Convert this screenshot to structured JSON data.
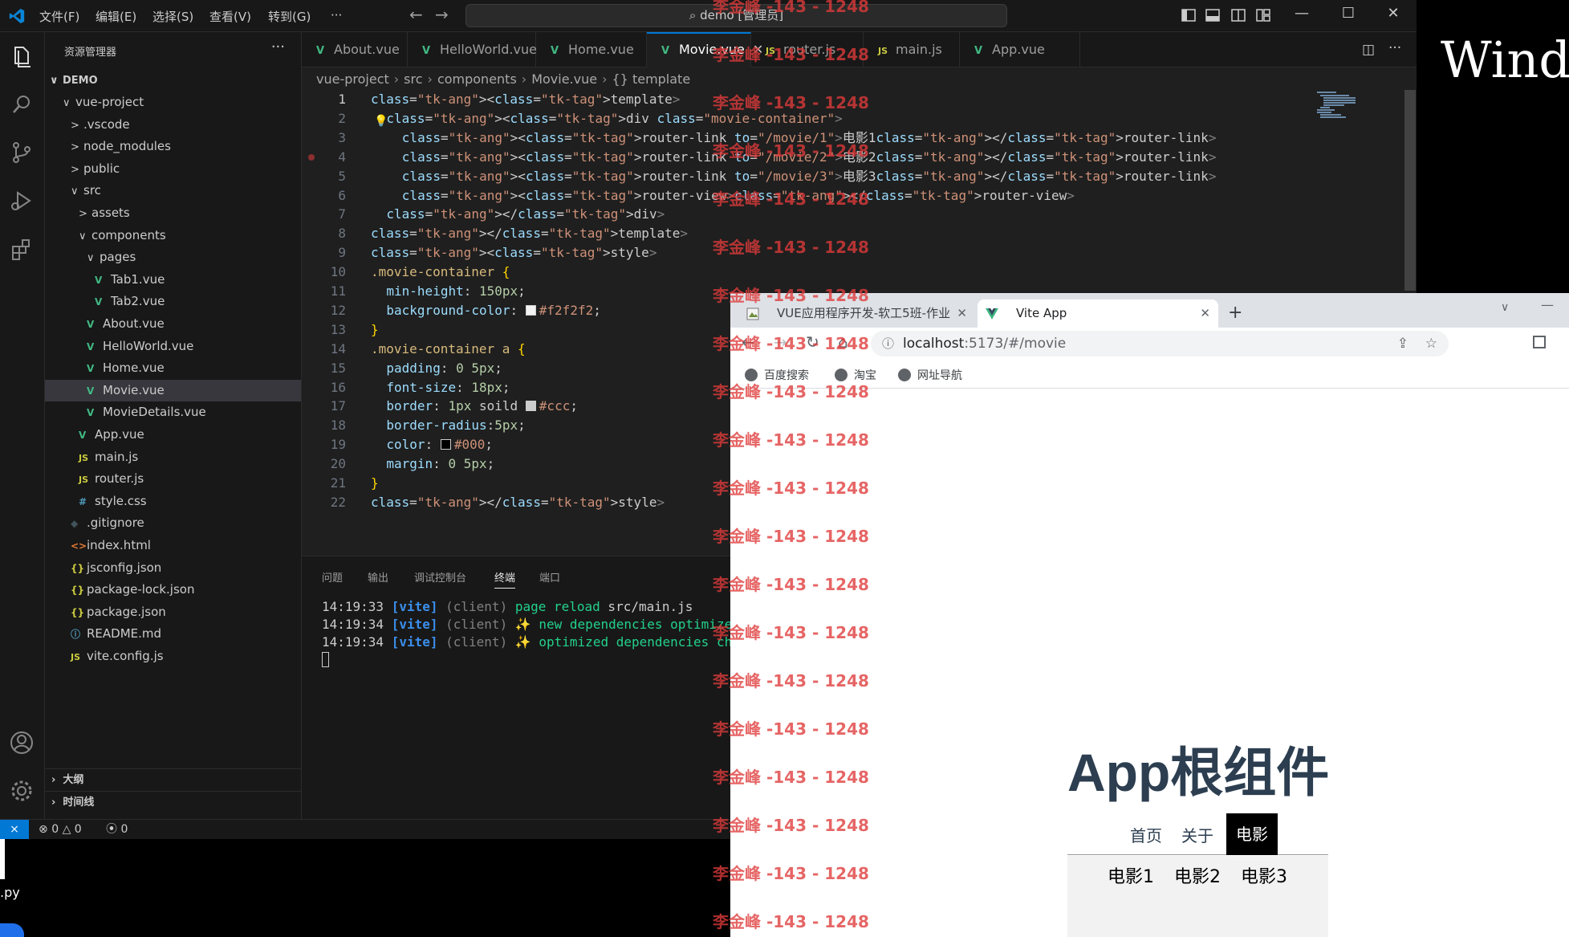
{
  "vscode": {
    "title": "demo [管理员]",
    "menu": [
      "文件(F)",
      "编辑(E)",
      "选择(S)",
      "查看(V)",
      "转到(G)",
      "···"
    ],
    "explorer_title": "资源管理器",
    "explorer_more": "···",
    "root": "DEMO",
    "tree": [
      {
        "label": "vue-project",
        "chev": "∨",
        "icon": "",
        "type": "folder"
      },
      {
        "label": ".vscode",
        "chev": ">",
        "icon": "",
        "type": "folder"
      },
      {
        "label": "node_modules",
        "chev": ">",
        "icon": "",
        "type": "folder"
      },
      {
        "label": "public",
        "chev": ">",
        "icon": "",
        "type": "folder"
      },
      {
        "label": "src",
        "chev": "∨",
        "icon": "",
        "type": "folder"
      },
      {
        "label": "assets",
        "chev": ">",
        "icon": "",
        "type": "folder"
      },
      {
        "label": "components",
        "chev": "∨",
        "icon": "",
        "type": "folder"
      },
      {
        "label": "pages",
        "chev": "∨",
        "icon": "",
        "type": "folder"
      },
      {
        "label": "Tab1.vue",
        "chev": "",
        "icon": "V",
        "type": "vue"
      },
      {
        "label": "Tab2.vue",
        "chev": "",
        "icon": "V",
        "type": "vue"
      },
      {
        "label": "About.vue",
        "chev": "",
        "icon": "V",
        "type": "vue"
      },
      {
        "label": "HelloWorld.vue",
        "chev": "",
        "icon": "V",
        "type": "vue"
      },
      {
        "label": "Home.vue",
        "chev": "",
        "icon": "V",
        "type": "vue"
      },
      {
        "label": "Movie.vue",
        "chev": "",
        "icon": "V",
        "type": "vue"
      },
      {
        "label": "MovieDetails.vue",
        "chev": "",
        "icon": "V",
        "type": "vue"
      },
      {
        "label": "App.vue",
        "chev": "",
        "icon": "V",
        "type": "vue"
      },
      {
        "label": "main.js",
        "chev": "",
        "icon": "JS",
        "type": "js"
      },
      {
        "label": "router.js",
        "chev": "",
        "icon": "JS",
        "type": "js"
      },
      {
        "label": "style.css",
        "chev": "",
        "icon": "#",
        "type": "css"
      },
      {
        "label": ".gitignore",
        "chev": "",
        "icon": "◆",
        "type": "git"
      },
      {
        "label": "index.html",
        "chev": "",
        "icon": "<>",
        "type": "html"
      },
      {
        "label": "jsconfig.json",
        "chev": "",
        "icon": "{}",
        "type": "json"
      },
      {
        "label": "package-lock.json",
        "chev": "",
        "icon": "{}",
        "type": "json"
      },
      {
        "label": "package.json",
        "chev": "",
        "icon": "{}",
        "type": "json"
      },
      {
        "label": "README.md",
        "chev": "",
        "icon": "ⓘ",
        "type": "info"
      },
      {
        "label": "vite.config.js",
        "chev": "",
        "icon": "JS",
        "type": "js"
      }
    ],
    "selected_file": "Movie.vue",
    "outline": "大纲",
    "timeline": "时间线",
    "tabs": [
      {
        "label": "About.vue",
        "icon": "V",
        "type": "vue"
      },
      {
        "label": "HelloWorld.vue",
        "icon": "V",
        "type": "vue"
      },
      {
        "label": "Home.vue",
        "icon": "V",
        "type": "vue"
      },
      {
        "label": "Movie.vue",
        "icon": "V",
        "type": "vue",
        "active": true
      },
      {
        "label": "router.js",
        "icon": "JS",
        "type": "js"
      },
      {
        "label": "main.js",
        "icon": "JS",
        "type": "js"
      },
      {
        "label": "App.vue",
        "icon": "V",
        "type": "vue"
      }
    ],
    "breadcrumb": [
      "vue-project",
      "src",
      "components",
      "Movie.vue",
      "{} template"
    ],
    "code_lines": [
      "<template>",
      "  <div class=\"movie-container\">",
      "    <router-link to=\"/movie/1\">电影1</router-link>",
      "    <router-link to=\"/movie/2\">电影2</router-link>",
      "    <router-link to=\"/movie/3\">电影3</router-link>",
      "    <router-view></router-view>",
      "  </div>",
      "</template>",
      "<style>",
      ".movie-container {",
      "  min-height: 150px;",
      "  background-color: #f2f2f2;",
      "}",
      ".movie-container a {",
      "  padding: 0 5px;",
      "  font-size: 18px;",
      "  border: 1px soild #ccc;",
      "  border-radius:5px;",
      "  color: #000;",
      "  margin: 0 5px;",
      "}",
      "</style>"
    ],
    "panel_tabs": [
      "问题",
      "输出",
      "调试控制台",
      "终端",
      "端口"
    ],
    "panel_active": "终端",
    "terminal": [
      {
        "time": "14:19:33",
        "tag": "[vite]",
        "src": "(client)",
        "msg": "page reload",
        "extra": "src/main.js"
      },
      {
        "time": "14:19:34",
        "tag": "[vite]",
        "src": "(client)",
        "msg": "✨ new dependencies optimized:",
        "extra": ""
      },
      {
        "time": "14:19:34",
        "tag": "[vite]",
        "src": "(client)",
        "msg": "✨ optimized dependencies chang",
        "extra": ""
      }
    ],
    "status": {
      "errors": "0",
      "warnings": "0",
      "ports": "0"
    }
  },
  "black_window": {
    "text": "Wind"
  },
  "remnant": {
    "text": ".py"
  },
  "chrome": {
    "tabs": [
      {
        "label": "VUE应用程序开发-软工5班-作业",
        "active": false
      },
      {
        "label": "Vite App",
        "active": true
      }
    ],
    "url_host": "localhost",
    "url_path": ":5173/#/movie",
    "bookmarks": [
      "百度搜索",
      "淘宝",
      "网址导航"
    ],
    "page": {
      "title": "App根组件",
      "nav": [
        "首页",
        "关于",
        "电影"
      ],
      "nav_active": "电影",
      "movies": [
        "电影1",
        "电影2",
        "电影3"
      ]
    }
  },
  "watermark": "李金峰 -143 - 1248",
  "colors": {
    "accent": "#0078d4",
    "vue": "#41b883",
    "watermark": "#e03b3b",
    "movie_bg": "#f2f2f2"
  }
}
